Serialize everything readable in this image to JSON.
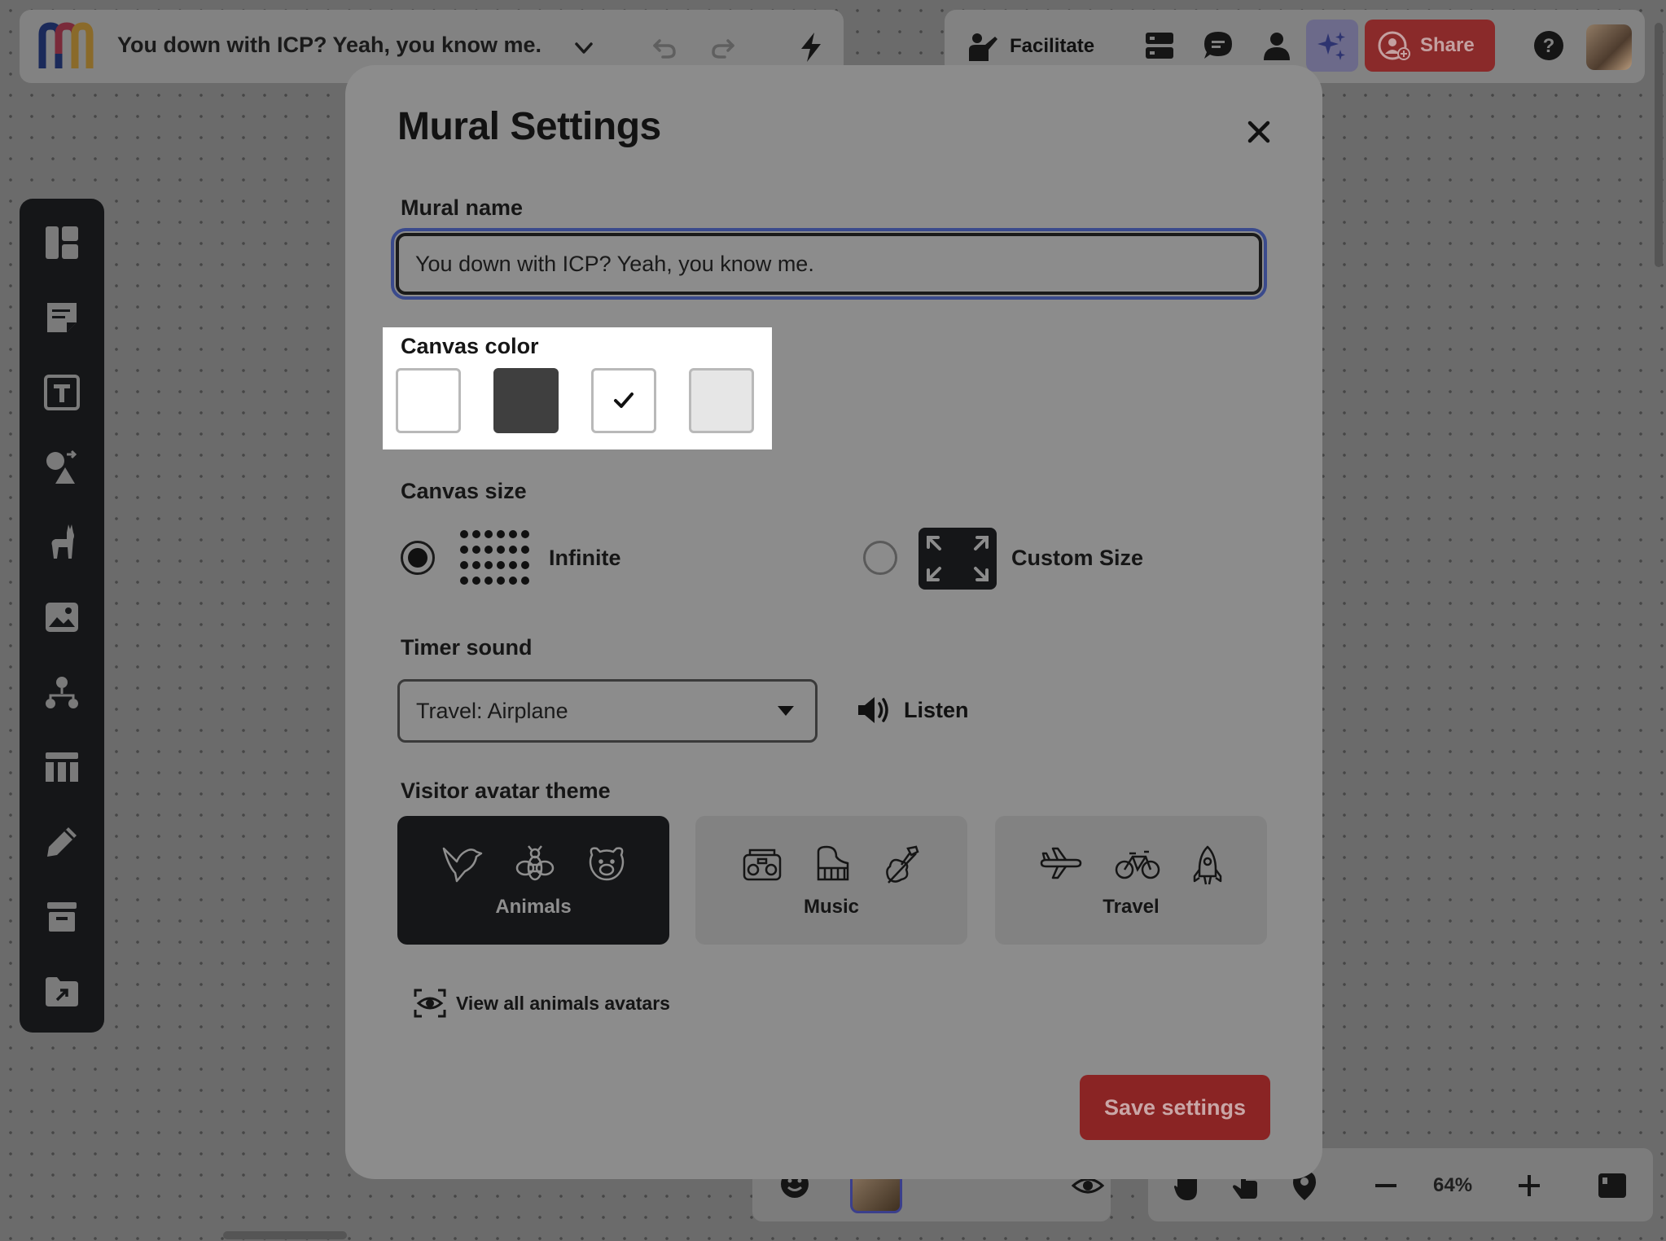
{
  "topbar": {
    "mural_title": "You down with ICP? Yeah, you know me.",
    "facilitate_label": "Facilitate",
    "share_label": "Share",
    "icons": [
      "undo-icon",
      "redo-icon",
      "lightning-icon",
      "outline-icon",
      "comments-icon",
      "people-icon",
      "ai-sparkle-icon",
      "help-icon"
    ]
  },
  "left_toolbar": {
    "items": [
      "templates-icon",
      "sticky-note-icon",
      "text-icon",
      "shapes-icon",
      "llama-icon",
      "image-icon",
      "diagram-icon",
      "table-icon",
      "pen-icon",
      "archive-icon",
      "upload-folder-icon"
    ]
  },
  "bottom_bar": {
    "zoom": "64%"
  },
  "modal": {
    "title": "Mural Settings",
    "mural_name_label": "Mural name",
    "mural_name_value": "You down with ICP? Yeah, you know me.",
    "canvas_color_label": "Canvas color",
    "canvas_colors": [
      {
        "color": "#ffffff",
        "selected": false
      },
      {
        "color": "#3f3f3f",
        "selected": false
      },
      {
        "color": "#ffffff",
        "selected": true
      },
      {
        "color": "#e6e6e6",
        "selected": false
      }
    ],
    "canvas_size_label": "Canvas size",
    "canvas_size_options": [
      {
        "label": "Infinite",
        "selected": true
      },
      {
        "label": "Custom Size",
        "selected": false
      }
    ],
    "timer_sound_label": "Timer sound",
    "timer_sound_value": "Travel: Airplane",
    "listen_label": "Listen",
    "visitor_avatar_label": "Visitor avatar theme",
    "avatar_themes": [
      {
        "label": "Animals",
        "selected": true,
        "icons": [
          "bird-icon",
          "bee-icon",
          "bear-icon"
        ]
      },
      {
        "label": "Music",
        "selected": false,
        "icons": [
          "boombox-icon",
          "piano-icon",
          "violin-icon"
        ]
      },
      {
        "label": "Travel",
        "selected": false,
        "icons": [
          "airplane-icon",
          "bicycle-icon",
          "rocket-icon"
        ]
      }
    ],
    "view_all_label": "View all animals avatars",
    "save_label": "Save settings"
  },
  "colors": {
    "overlay_bg": "#6b6b6b",
    "modal_bg": "#8c8c8c",
    "accent_red": "#8a2424",
    "dark": "#151618"
  }
}
